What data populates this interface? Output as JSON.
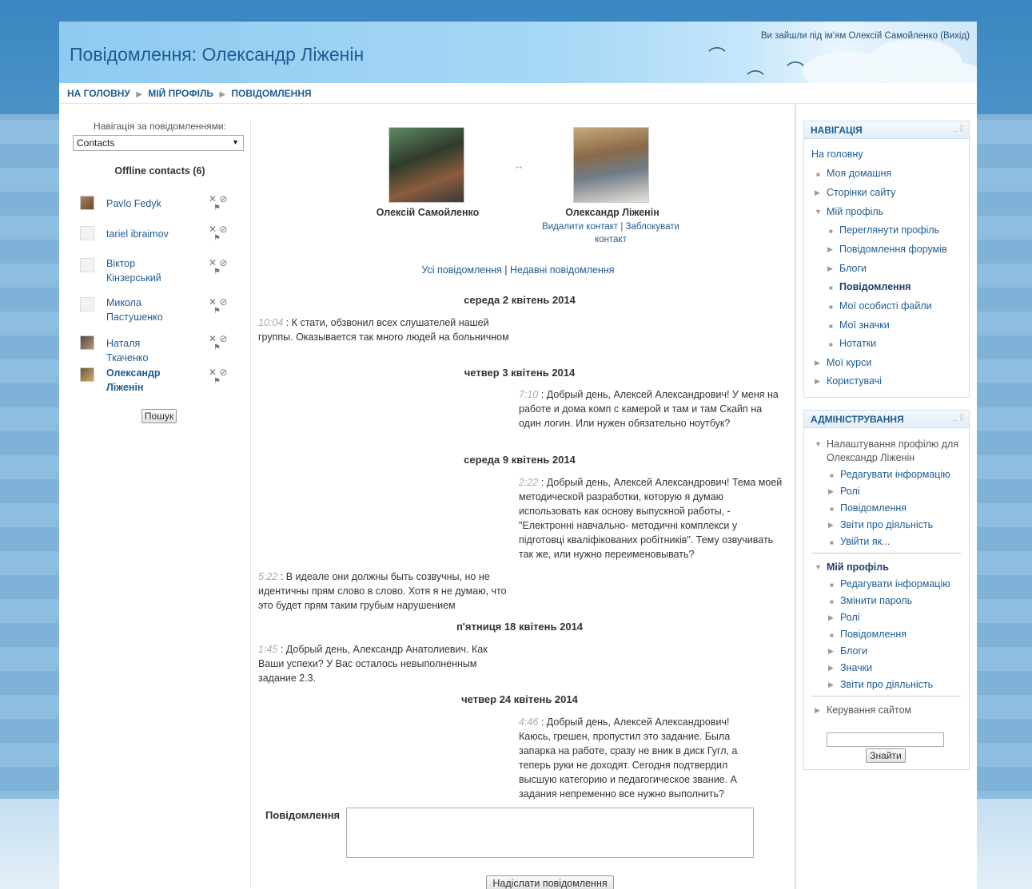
{
  "header": {
    "title": "Повідомлення: Олександр Ліженін",
    "login_prefix": "Ви зайшли під ім'ям ",
    "login_user": "Олексій Самойленко",
    "logout": "(Вихід)"
  },
  "breadcrumb": {
    "home": "НА ГОЛОВНУ",
    "profile": "МІЙ ПРОФІЛЬ",
    "messages": "ПОВІДОМЛЕННЯ"
  },
  "left": {
    "nav_label": "Навігація за повідомленнями:",
    "select_value": "Contacts",
    "offline_title": "Offline contacts (6)",
    "contacts": [
      {
        "name": "Pavlo Fedyk"
      },
      {
        "name": "tariel ibraimov"
      },
      {
        "name": "Віктор Кінзерський"
      },
      {
        "name": "Микола Пастушенко"
      },
      {
        "name": "Наталя Ткаченко"
      },
      {
        "name": "Олександр Ліженін"
      }
    ],
    "search_button": "Пошук"
  },
  "center": {
    "user_me": "Олексій Самойленко",
    "user_other": "Олександр Ліженін",
    "remove_contact": "Видалити контакт",
    "block_contact": "Заблокувати контакт",
    "all_messages": "Усі повідомлення",
    "recent_messages": "Недавні повідомлення",
    "days": [
      "середа 2 квітень 2014",
      "четвер 3 квітень 2014",
      "середа 9 квітень 2014",
      "п'ятниця 18 квітень 2014",
      "четвер 24 квітень 2014"
    ],
    "messages": [
      {
        "time": "10:04",
        "text": "К стати, обзвонил всех слушателей нашей группы. Оказывается так много людей на больничном"
      },
      {
        "time": "7:10",
        "text": "Добрый день, Алексей Александрович! У меня на работе и дома комп с камерой и там и там Скайп на один логин. Или нужен обязательно ноутбук?"
      },
      {
        "time": "2:22",
        "text": "Добрый день, Алексей Александрович! Тема моей методической разработки, которую я думаю использовать как основу выпускной работы, - \"Електронні навчально- методичні комплекси у підготовці кваліфікованих робітників\". Тему озвучивать так же, или нужно переименовывать?"
      },
      {
        "time": "5:22",
        "text": "В идеале они должны быть созвучны, но не идентичны прям слово в слово. Хотя я не думаю, что это будет прям таким грубым нарушением"
      },
      {
        "time": "1:45",
        "text": "Добрый день, Александр Анатолиевич. Как Ваши успехи? У Вас осталось невыполненным задание 2.3."
      },
      {
        "time": "4:46",
        "text": "Добрый день, Алексей Александрович! Каюсь, грешен, пропустил это задание. Была запарка на работе, сразу не вник в диск Гугл, а теперь руки не доходят. Сегодня подтвердил высшую категорию и педагогическое звание. А задания непременно все нужно выполнить?"
      }
    ],
    "message_label": "Повідомлення",
    "send_button": "Надіслати повідомлення"
  },
  "nav_block": {
    "title": "НАВІГАЦІЯ",
    "items": [
      "На головну",
      "Моя домашня",
      "Сторінки сайту",
      "Мій профіль",
      "Переглянути профіль",
      "Повідомлення форумів",
      "Блоги",
      "Повідомлення",
      "Мої особисті файли",
      "Мої значки",
      "Нотатки",
      "Мої курси",
      "Користувачі"
    ]
  },
  "admin_block": {
    "title": "АДМІНІСТРУВАННЯ",
    "profile_settings": "Налаштування профілю для Олександр Ліженін",
    "items_a": [
      "Редагувати інформацію",
      "Ролі",
      "Повідомлення",
      "Звіти про діяльність",
      "Увійти як..."
    ],
    "my_profile": "Мій профіль",
    "items_b": [
      "Редагувати інформацію",
      "Змінити пароль",
      "Ролі",
      "Повідомлення",
      "Блоги",
      "Значки",
      "Звіти про діяльність"
    ],
    "site_admin": "Керування сайтом",
    "find_button": "Знайти"
  }
}
